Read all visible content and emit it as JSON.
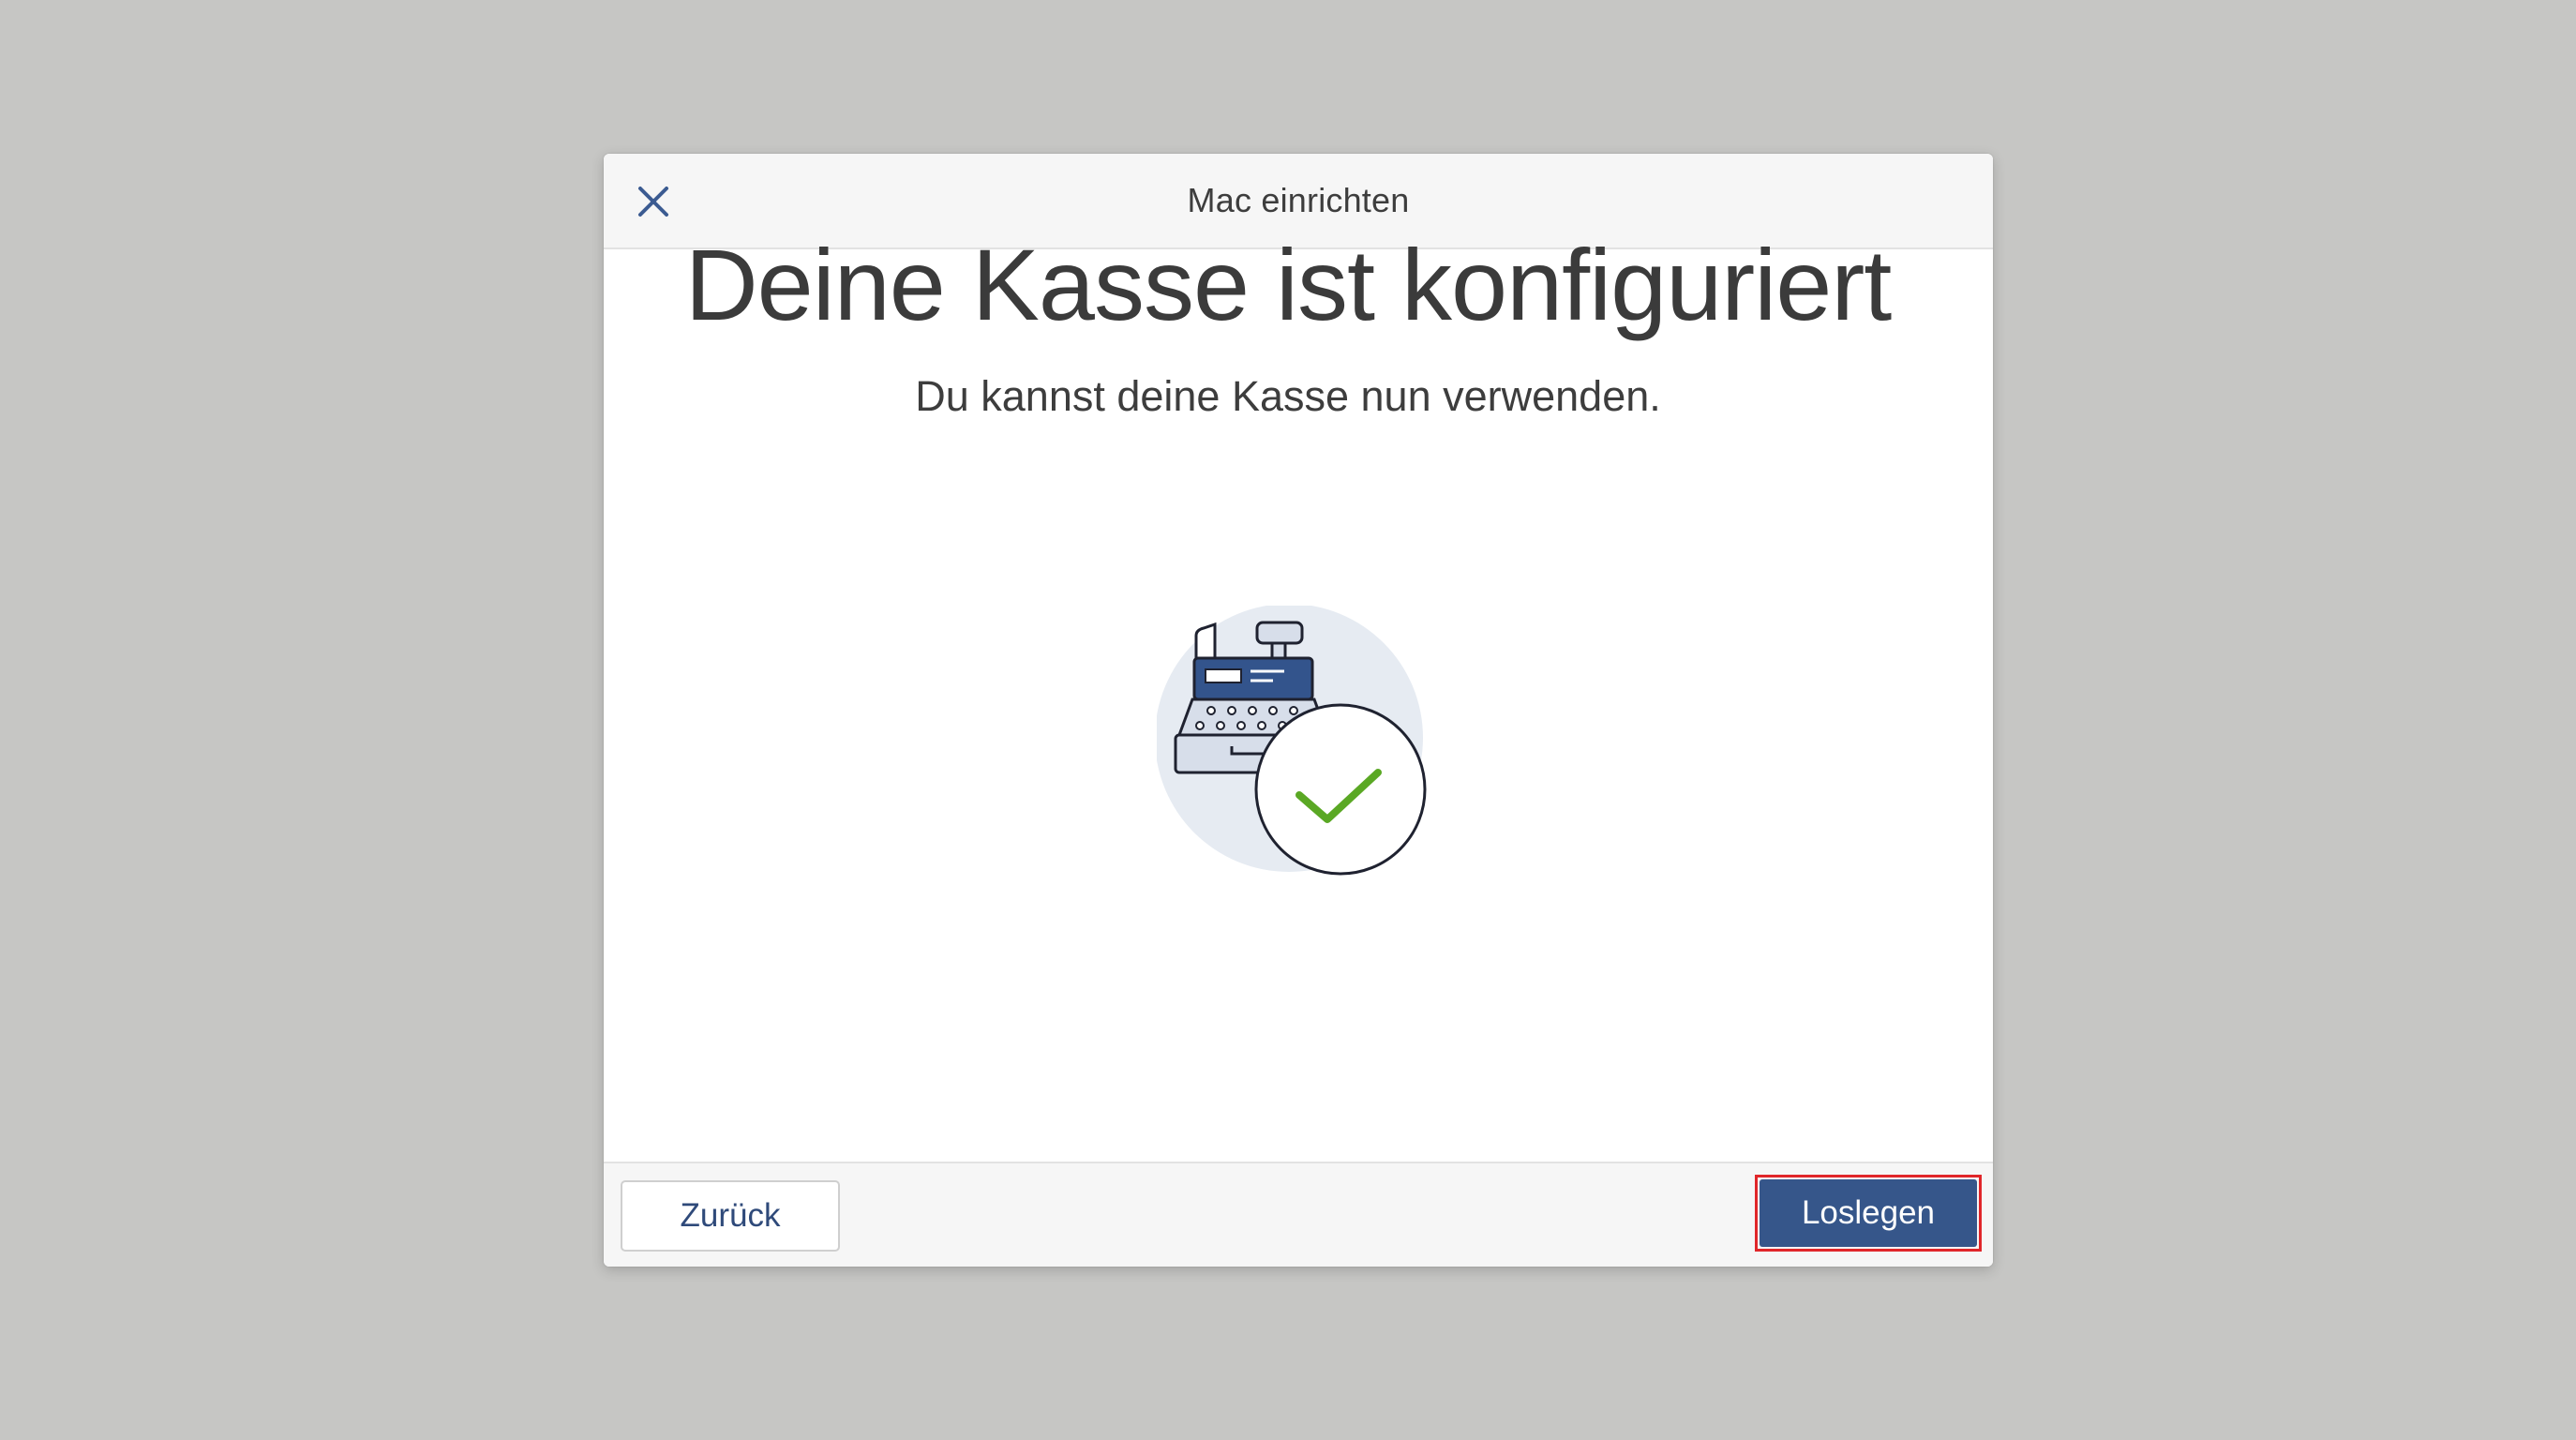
{
  "dialog": {
    "title": "Mac einrichten",
    "close_icon": "close-icon"
  },
  "body": {
    "headline": "Deine Kasse ist konfiguriert",
    "subline": "Du kannst deine Kasse nun verwenden.",
    "illustration_icon": "cash-register-check-icon"
  },
  "footer": {
    "back_label": "Zurück",
    "primary_label": "Loslegen"
  },
  "colors": {
    "background": "#c6c6c4",
    "primary": "#36568a",
    "check": "#5aa824",
    "highlight_outline": "#e0262a",
    "text": "#3b3b3b"
  }
}
